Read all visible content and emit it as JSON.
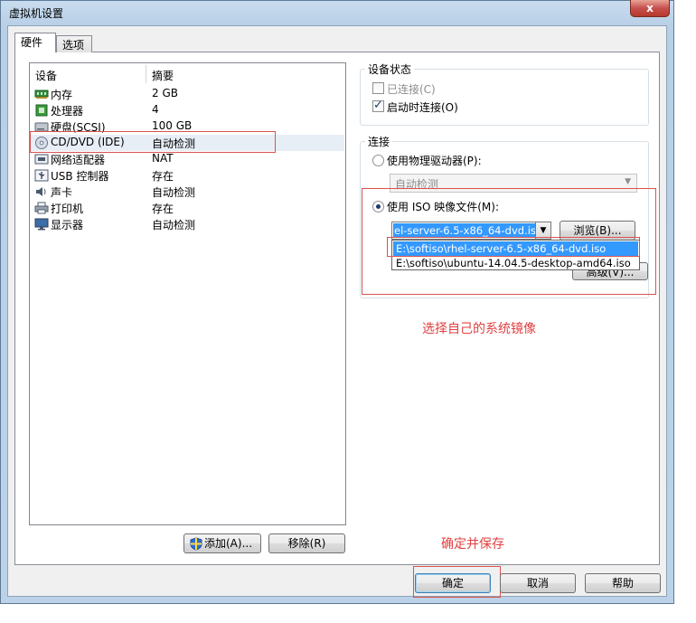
{
  "window": {
    "title": "虚拟机设置",
    "close_label": "x"
  },
  "tabs": [
    {
      "label": "硬件"
    },
    {
      "label": "选项"
    }
  ],
  "device_list": {
    "headers": {
      "device": "设备",
      "summary": "摘要"
    },
    "rows": [
      {
        "name": "内存",
        "summary": "2 GB",
        "icon": "memory-icon"
      },
      {
        "name": "处理器",
        "summary": "4",
        "icon": "cpu-icon"
      },
      {
        "name": "硬盘(SCSI)",
        "summary": "100 GB",
        "icon": "harddisk-icon"
      },
      {
        "name": "CD/DVD (IDE)",
        "summary": "自动检测",
        "icon": "cd-dvd-icon"
      },
      {
        "name": "网络适配器",
        "summary": "NAT",
        "icon": "network-adapter-icon"
      },
      {
        "name": "USB 控制器",
        "summary": "存在",
        "icon": "usb-icon"
      },
      {
        "name": "声卡",
        "summary": "自动检测",
        "icon": "speaker-icon"
      },
      {
        "name": "打印机",
        "summary": "存在",
        "icon": "printer-icon"
      },
      {
        "name": "显示器",
        "summary": "自动检测",
        "icon": "monitor-icon"
      }
    ],
    "selected_index": 3
  },
  "device_status": {
    "legend": "设备状态",
    "connected_label": "已连接(C)",
    "connected_checked": false,
    "connect_at_power_on_label": "启动时连接(O)",
    "connect_at_power_on_checked": true
  },
  "connection": {
    "legend": "连接",
    "physical_drive_label": "使用物理驱动器(P):",
    "physical_drive_value": "自动检测",
    "iso_label": "使用 ISO 映像文件(M):",
    "iso_value": "el-server-6.5-x86_64-dvd.iso",
    "iso_options": [
      "E:\\softiso\\rhel-server-6.5-x86_64-dvd.iso",
      "E:\\softiso\\ubuntu-14.04.5-desktop-amd64.iso"
    ],
    "browse_label": "浏览(B)...",
    "advanced_label": "高级(V)..."
  },
  "buttons": {
    "add_label": "添加(A)...",
    "remove_label": "移除(R)",
    "ok_label": "确定",
    "cancel_label": "取消",
    "help_label": "帮助"
  },
  "annotations": {
    "select_iso_note": "选择自己的系统镜像",
    "confirm_note": "确定并保存"
  },
  "colors": {
    "annotation_red": "#e04040",
    "selection_blue": "#3399ff"
  }
}
